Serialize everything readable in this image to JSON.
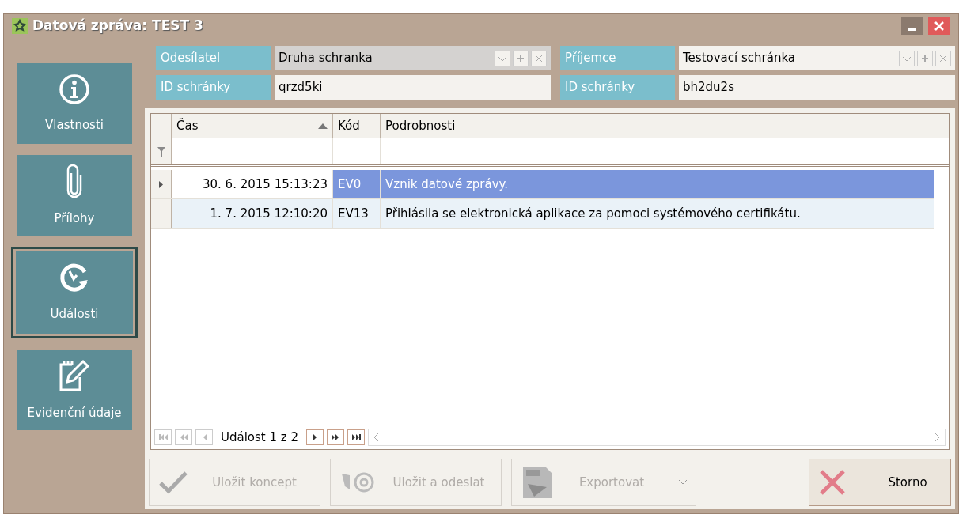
{
  "window": {
    "title": "Datová zpráva: TEST 3"
  },
  "sender": {
    "label": "Odesílatel",
    "value": "Druha schranka",
    "id_label": "ID schránky",
    "id_value": "qrzd5ki"
  },
  "recipient": {
    "label": "Příjemce",
    "value": "Testovací schránka",
    "id_label": "ID schránky",
    "id_value": "bh2du2s"
  },
  "nav": [
    {
      "kind": "info",
      "label": "Vlastnosti",
      "selected": false
    },
    {
      "kind": "clip",
      "label": "Přílohy",
      "selected": false
    },
    {
      "kind": "clock",
      "label": "Události",
      "selected": true
    },
    {
      "kind": "edit",
      "label": "Evidenční údaje",
      "selected": false
    }
  ],
  "table": {
    "columns": [
      {
        "label": "Čas",
        "sorted": true
      },
      {
        "label": "Kód",
        "sorted": false
      },
      {
        "label": "Podrobnosti",
        "sorted": false
      }
    ],
    "rows": [
      {
        "cells": [
          "30. 6. 2015 15:13:23",
          "EV0",
          "Vznik datové zprávy."
        ],
        "selected": true
      },
      {
        "cells": [
          "1. 7. 2015 12:10:20",
          "EV13",
          "Přihlásila se elektronická aplikace za pomoci systémového certifikátu."
        ],
        "selected": false
      }
    ]
  },
  "pager": {
    "text": "Událost 1 z 2"
  },
  "buttons": [
    {
      "kind": "check",
      "label": "Uložit koncept",
      "disabled": true
    },
    {
      "kind": "send",
      "label": "Uložit a odeslat",
      "disabled": true
    },
    {
      "kind": "export",
      "label": "Exportovat",
      "disabled": true
    },
    {
      "kind": "cancel",
      "label": "Storno",
      "disabled": false
    }
  ]
}
